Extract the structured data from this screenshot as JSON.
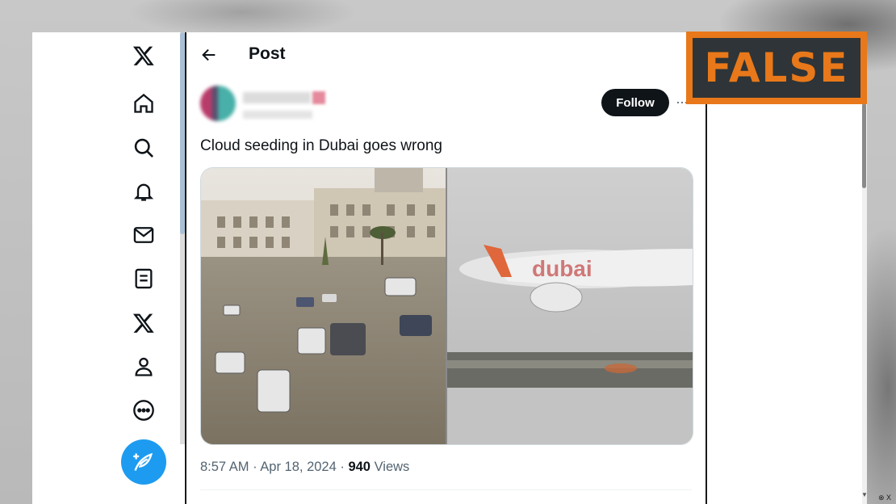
{
  "header": {
    "title": "Post"
  },
  "post": {
    "text": "Cloud seeding in Dubai goes wrong",
    "follow_label": "Follow",
    "more_label": "···",
    "time": "8:57 AM · Apr 18, 2024 · ",
    "views_count": "940",
    "views_label": " Views",
    "media_right_label": "dubai"
  },
  "sidebar": {
    "items": [
      {
        "icon": "x-logo-icon"
      },
      {
        "icon": "home-icon"
      },
      {
        "icon": "search-icon"
      },
      {
        "icon": "bell-icon"
      },
      {
        "icon": "mail-icon"
      },
      {
        "icon": "list-icon"
      },
      {
        "icon": "x-premium-icon"
      },
      {
        "icon": "profile-icon"
      },
      {
        "icon": "more-icon"
      }
    ],
    "compose_icon": "feather-icon"
  },
  "badge": {
    "label": "FALSE",
    "accent": "#e8781a",
    "background": "#2e3437"
  },
  "corner": {
    "label": "⊗ X"
  },
  "colors": {
    "brand": "#1d9bf0",
    "text": "#0f1419",
    "muted": "#536471"
  }
}
